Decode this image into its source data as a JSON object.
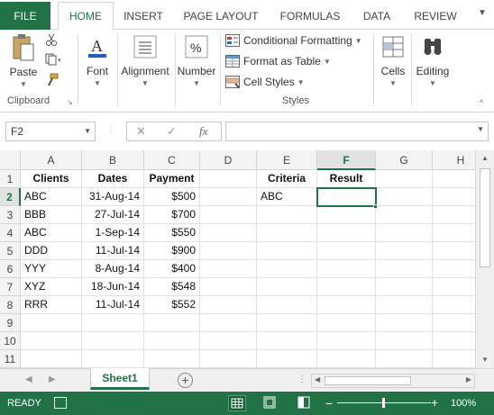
{
  "ribbon_tabs": [
    "FILE",
    "HOME",
    "INSERT",
    "PAGE LAYOUT",
    "FORMULAS",
    "DATA",
    "REVIEW"
  ],
  "active_tab": "HOME",
  "ribbon": {
    "clipboard": {
      "paste_label": "Paste",
      "group_label": "Clipboard"
    },
    "font_label": "Font",
    "alignment_label": "Alignment",
    "number_label": "Number",
    "styles": {
      "conditional_formatting": "Conditional Formatting",
      "format_as_table": "Format as Table",
      "cell_styles": "Cell Styles",
      "group_label": "Styles"
    },
    "cells_label": "Cells",
    "editing_label": "Editing"
  },
  "formula_bar": {
    "name_box": "F2",
    "fx": "fx",
    "formula": ""
  },
  "columns": [
    "A",
    "B",
    "C",
    "D",
    "E",
    "F",
    "G",
    "H"
  ],
  "selected_column": "F",
  "row_numbers": [
    "1",
    "2",
    "3",
    "4",
    "5",
    "6",
    "7",
    "8",
    "9",
    "10",
    "11"
  ],
  "selected_row": "2",
  "headers": {
    "clients": "Clients",
    "dates": "Dates",
    "payment": "Payment",
    "criteria": "Criteria",
    "result": "Result"
  },
  "rows": [
    {
      "client": "ABC",
      "date": "31-Aug-14",
      "payment": "$500"
    },
    {
      "client": "BBB",
      "date": "27-Jul-14",
      "payment": "$700"
    },
    {
      "client": "ABC",
      "date": "1-Sep-14",
      "payment": "$550"
    },
    {
      "client": "DDD",
      "date": "11-Jul-14",
      "payment": "$900"
    },
    {
      "client": "YYY",
      "date": "8-Aug-14",
      "payment": "$400"
    },
    {
      "client": "XYZ",
      "date": "18-Jun-14",
      "payment": "$548"
    },
    {
      "client": "RRR",
      "date": "11-Jul-14",
      "payment": "$552"
    }
  ],
  "criteria_value": "ABC",
  "result_value": "",
  "sheet_tab": "Sheet1",
  "status": {
    "ready": "READY",
    "zoom": "100%"
  },
  "colors": {
    "accent": "#217346"
  }
}
